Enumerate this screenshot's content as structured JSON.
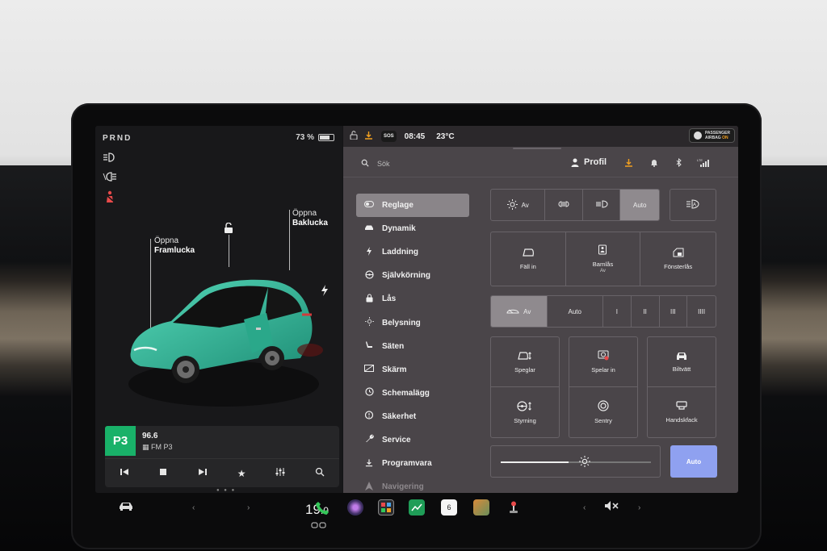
{
  "left": {
    "gear": "PRND",
    "battery": "73 %",
    "battery_level": 0.73,
    "callout_front_line1": "Öppna",
    "callout_front_line2": "Framlucka",
    "callout_rear_line1": "Öppna",
    "callout_rear_line2": "Baklucka",
    "icons": [
      "headlight-icon",
      "fog-light-icon",
      "seatbelt-warning-icon",
      "unlock-icon",
      "charge-port-icon"
    ]
  },
  "media": {
    "logo": "P3",
    "frequency": "96.6",
    "station": "FM P3",
    "controls": [
      "previous-icon",
      "stop-icon",
      "next-icon",
      "favorite-icon",
      "equalizer-icon",
      "search-icon"
    ]
  },
  "status": {
    "sos": "SOS",
    "time": "08:45",
    "temperature": "23°C",
    "airbag_line1": "PASSENGER",
    "airbag_line2": "AIRBAG",
    "airbag_state": "ON"
  },
  "search": {
    "placeholder": "Sök"
  },
  "profile": {
    "label": "Profil"
  },
  "menu": [
    {
      "label": "Reglage",
      "icon": "toggle-icon"
    },
    {
      "label": "Dynamik",
      "icon": "car-icon"
    },
    {
      "label": "Laddning",
      "icon": "lightning-icon"
    },
    {
      "label": "Självkörning",
      "icon": "steering-wheel-icon"
    },
    {
      "label": "Lås",
      "icon": "lock-icon"
    },
    {
      "label": "Belysning",
      "icon": "bulb-icon"
    },
    {
      "label": "Säten",
      "icon": "seat-icon"
    },
    {
      "label": "Skärm",
      "icon": "display-icon"
    },
    {
      "label": "Schemalägg",
      "icon": "clock-icon"
    },
    {
      "label": "Säkerhet",
      "icon": "shield-icon"
    },
    {
      "label": "Service",
      "icon": "wrench-icon"
    },
    {
      "label": "Programvara",
      "icon": "download-icon"
    },
    {
      "label": "Navigering",
      "icon": "navigation-icon"
    }
  ],
  "lights": {
    "off": "Av",
    "auto": "Auto"
  },
  "mirror_row": {
    "fold": "Fäll in",
    "child_lock": "Barnlås",
    "child_lock_state": "Av",
    "window_lock": "Fönsterlås"
  },
  "wipers": {
    "off": "Av",
    "auto": "Auto",
    "speeds": [
      "I",
      "II",
      "III",
      "IIII"
    ]
  },
  "tiles": {
    "mirrors": "Speglar",
    "dashcam": "Spelar in",
    "carwash": "Biltvätt",
    "steering": "Styrning",
    "sentry": "Sentry",
    "glovebox": "Handskfack"
  },
  "brightness": {
    "level": 0.45,
    "auto": "Auto"
  },
  "dock": {
    "temperature": "19",
    "temperature_decimal": ".0",
    "calendar_day": "6"
  },
  "colors": {
    "accent_orange": "#f2a020",
    "auto_button": "#8fa1f0",
    "radio_green": "#19b169",
    "car_teal": "#37c2a2"
  }
}
